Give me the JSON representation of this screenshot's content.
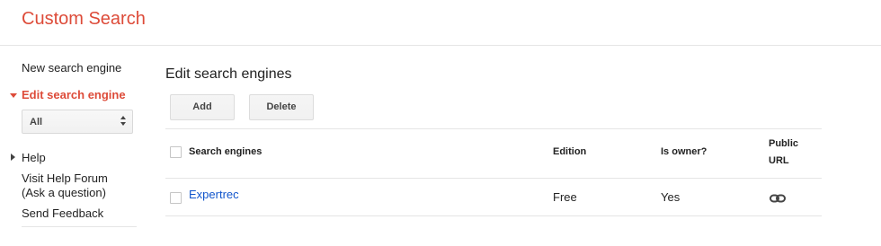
{
  "app": {
    "title": "Custom Search"
  },
  "sidebar": {
    "items": [
      {
        "label": "New search engine"
      },
      {
        "label": "Edit search engine"
      },
      {
        "label": "Help"
      },
      {
        "label": "Visit Help Forum"
      },
      {
        "label": "(Ask a question)"
      },
      {
        "label": "Send Feedback"
      }
    ],
    "filter": {
      "selected": "All"
    }
  },
  "main": {
    "title": "Edit search engines",
    "buttons": {
      "add": "Add",
      "delete": "Delete"
    },
    "table": {
      "headers": {
        "name": "Search engines",
        "edition": "Edition",
        "owner": "Is owner?",
        "public_url_1": "Public",
        "public_url_2": "URL"
      },
      "rows": [
        {
          "name": "Expertrec",
          "edition": "Free",
          "owner": "Yes",
          "public_url_icon": "link-icon"
        }
      ]
    }
  },
  "colors": {
    "accent": "#dd4b39",
    "link": "#1155cc"
  }
}
